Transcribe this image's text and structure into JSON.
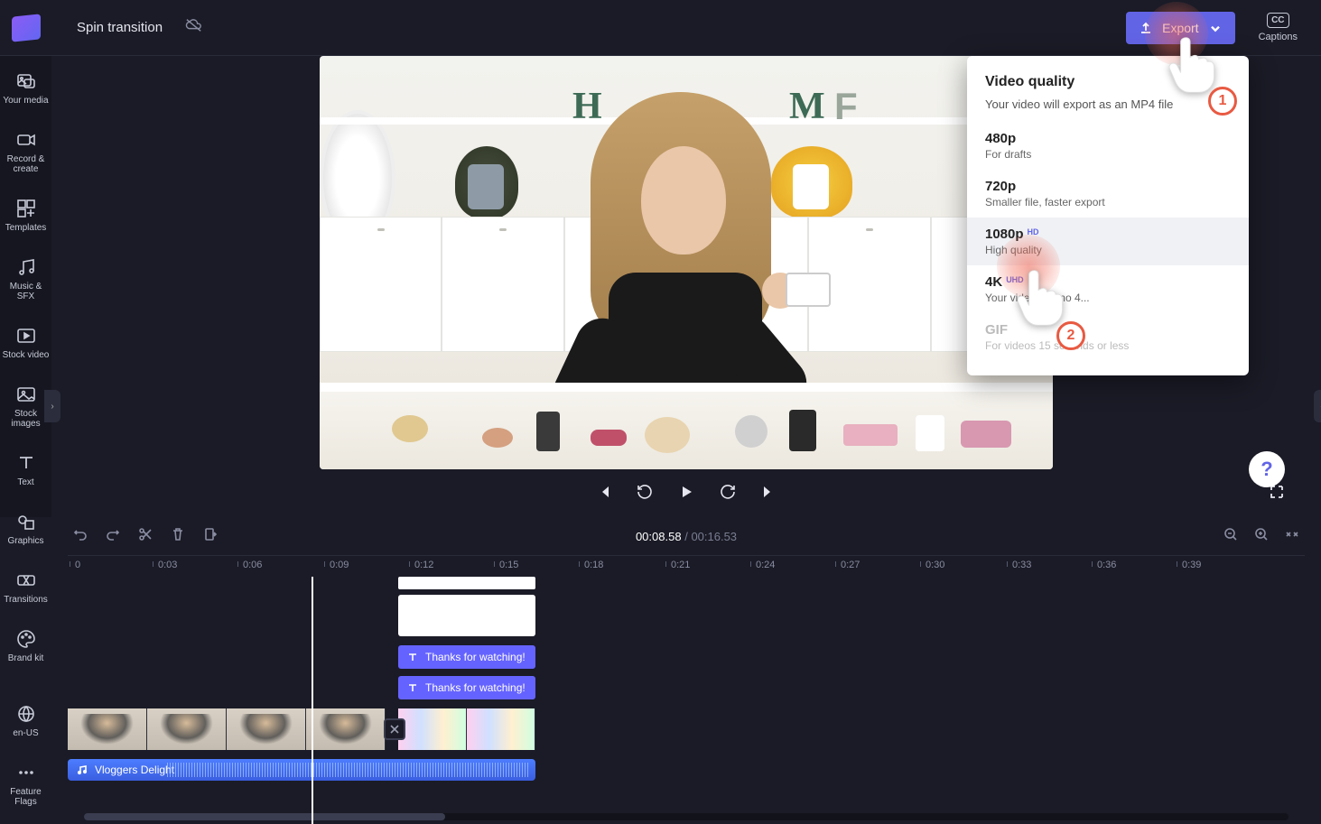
{
  "topbar": {
    "project_title": "Spin transition",
    "export_label": "Export",
    "captions_label": "Captions",
    "cc": "CC"
  },
  "sidebar": {
    "items": [
      {
        "label": "Your media"
      },
      {
        "label": "Record & create"
      },
      {
        "label": "Templates"
      },
      {
        "label": "Music & SFX"
      },
      {
        "label": "Stock video"
      },
      {
        "label": "Stock images"
      },
      {
        "label": "Text"
      },
      {
        "label": "Graphics"
      },
      {
        "label": "Transitions"
      },
      {
        "label": "Brand kit"
      }
    ],
    "bottom": [
      {
        "label": "en-US"
      },
      {
        "label": "Feature Flags"
      }
    ]
  },
  "export_popover": {
    "title": "Video quality",
    "subtitle": "Your video will export as an MP4 file",
    "options": [
      {
        "title": "480p",
        "sub": "For drafts"
      },
      {
        "title": "720p",
        "sub": "Smaller file, faster export"
      },
      {
        "title": "1080p",
        "badge": "HD",
        "sub": "High quality"
      },
      {
        "title": "4K",
        "badge": "UHD",
        "sub": "Your video has no 4..."
      },
      {
        "title": "GIF",
        "sub": "For videos 15 seconds or less"
      }
    ]
  },
  "playback": {
    "current": "00:08.58",
    "sep": "/",
    "total": "00:16.53"
  },
  "timeline": {
    "ticks": [
      "0",
      "0:03",
      "0:06",
      "0:09",
      "0:12",
      "0:15",
      "0:18",
      "0:21",
      "0:24",
      "0:27",
      "0:30",
      "0:33",
      "0:36",
      "0:39"
    ],
    "text_clip_1": "Thanks for watching!",
    "text_clip_2": "Thanks for watching!",
    "audio_clip": "Vloggers Delight"
  },
  "annotations": {
    "n1": "1",
    "n2": "2"
  },
  "help": "?"
}
